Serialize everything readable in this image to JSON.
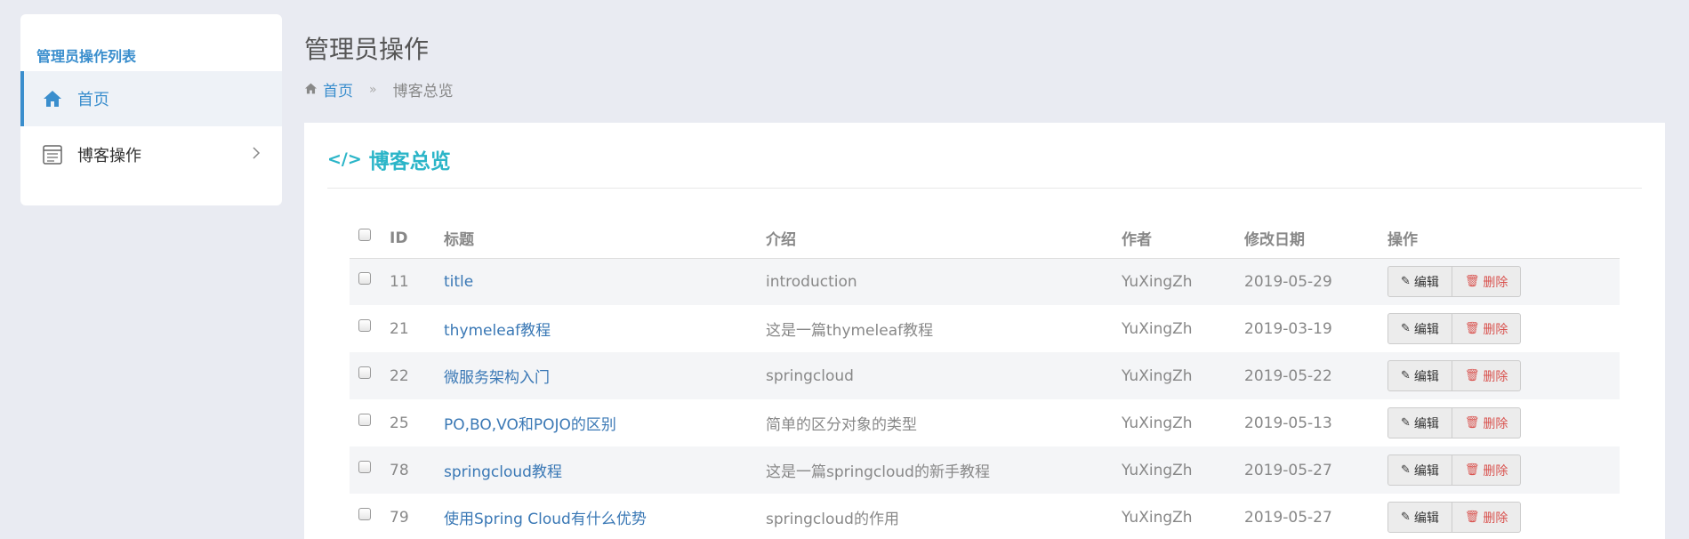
{
  "sidebar": {
    "heading": "管理员操作列表",
    "items": [
      {
        "label": "首页",
        "icon": "home-icon"
      },
      {
        "label": "博客操作",
        "icon": "list-icon"
      }
    ]
  },
  "header": {
    "title": "管理员操作",
    "breadcrumb": {
      "home": "首页",
      "separator": "»",
      "current": "博客总览"
    }
  },
  "panel": {
    "icon": "</>",
    "title": "博客总览"
  },
  "table": {
    "columns": [
      "ID",
      "标题",
      "介绍",
      "作者",
      "修改日期",
      "操作"
    ],
    "rows": [
      {
        "id": "11",
        "title": "title",
        "intro": "introduction",
        "author": "YuXingZh",
        "date": "2019-05-29"
      },
      {
        "id": "21",
        "title": "thymeleaf教程",
        "intro": "这是一篇thymeleaf教程",
        "author": "YuXingZh",
        "date": "2019-03-19"
      },
      {
        "id": "22",
        "title": "微服务架构入门",
        "intro": "springcloud",
        "author": "YuXingZh",
        "date": "2019-05-22"
      },
      {
        "id": "25",
        "title": "PO,BO,VO和POJO的区别",
        "intro": "简单的区分对象的类型",
        "author": "YuXingZh",
        "date": "2019-05-13"
      },
      {
        "id": "78",
        "title": "springcloud教程",
        "intro": "这是一篇springcloud的新手教程",
        "author": "YuXingZh",
        "date": "2019-05-27"
      },
      {
        "id": "79",
        "title": "使用Spring Cloud有什么优势",
        "intro": "springcloud的作用",
        "author": "YuXingZh",
        "date": "2019-05-27"
      }
    ],
    "edit_label": "编辑",
    "delete_label": "删除"
  },
  "colors": {
    "accent": "#3a8ecd",
    "panel_title": "#2bb5c8",
    "delete": "#d9534f"
  }
}
